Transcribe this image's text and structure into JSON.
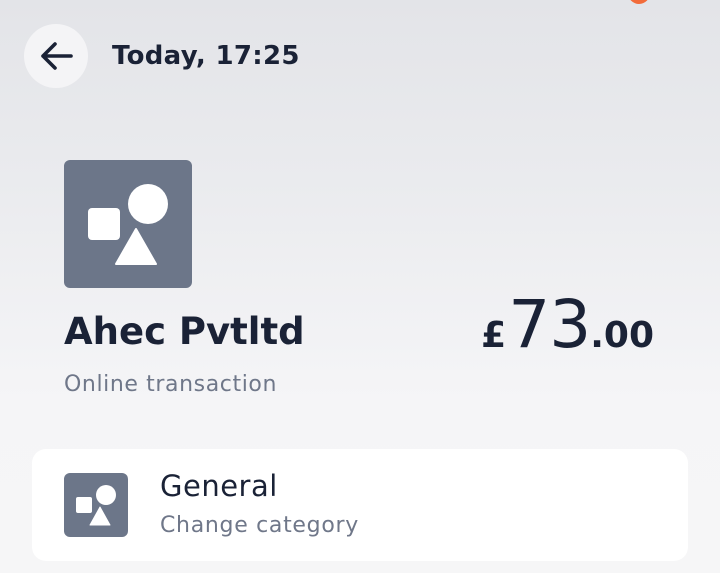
{
  "header": {
    "back_icon": "arrow-left-icon",
    "title": "Today, 17:25"
  },
  "merchant": {
    "logo_icon": "shapes-icon",
    "name": "Ahec Pvtltd",
    "subtitle": "Online transaction"
  },
  "amount": {
    "currency": "£",
    "major": "73",
    "minor": ".00"
  },
  "category": {
    "icon": "shapes-icon",
    "name": "General",
    "action": "Change category"
  },
  "colors": {
    "text_primary": "#1a2236",
    "text_secondary": "#6f7789",
    "icon_tile": "#6c7689",
    "notification_dot": "#f26b3a",
    "card_background": "#ffffff"
  }
}
